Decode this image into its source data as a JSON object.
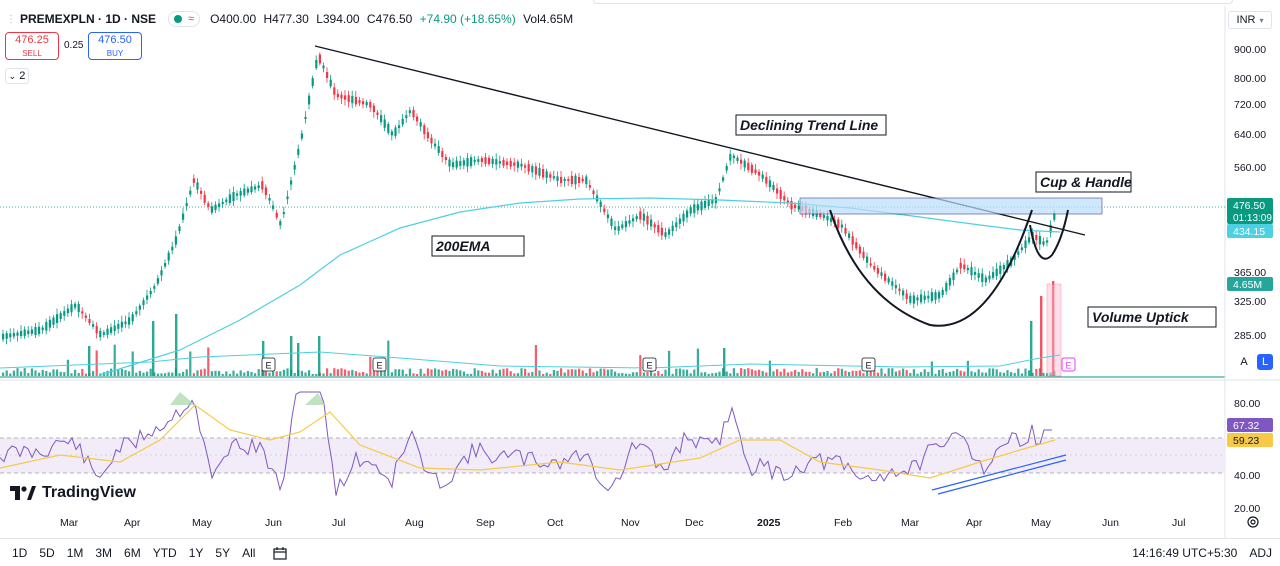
{
  "legend": {
    "symbol": "PREMEXPLN · 1D · NSE",
    "open": "O400.00",
    "high": "H477.30",
    "low": "L394.00",
    "close": "C476.50",
    "change": "+74.90 (+18.65%)",
    "volume": "Vol4.65M"
  },
  "trade": {
    "sell_price": "476.25",
    "sell_label": "SELL",
    "spread": "0.25",
    "buy_price": "476.50",
    "buy_label": "BUY"
  },
  "collapse_count": "2",
  "currency": "INR",
  "price_axis": {
    "ticks": [
      "900.00",
      "800.00",
      "720.00",
      "640.00",
      "560.00",
      "365.00",
      "325.00",
      "285.00"
    ],
    "last_price": "476.50",
    "countdown": "01:13:09",
    "ema_value": "434.15",
    "volume_value": "4.65M"
  },
  "rsi_axis": {
    "ticks": [
      "80.00",
      "40.00",
      "20.00"
    ],
    "rsi_value": "67.32",
    "rsi_ma_value": "59.23"
  },
  "time_axis": [
    "Mar",
    "Apr",
    "May",
    "Jun",
    "Jul",
    "Aug",
    "Sep",
    "Oct",
    "Nov",
    "Dec",
    "2025",
    "Feb",
    "Mar",
    "Apr",
    "May",
    "Jun",
    "Jul"
  ],
  "annotations": {
    "trend_line": "Declining Trend Line",
    "cup_handle": "Cup & Handle",
    "ema200": "200EMA",
    "volume_uptick": "Volume Uptick"
  },
  "earnings_marker": "E",
  "logo_text": "TradingView",
  "timeframes": [
    "1D",
    "5D",
    "1M",
    "3M",
    "6M",
    "YTD",
    "1Y",
    "5Y",
    "All"
  ],
  "clock": "14:16:49 UTC+5:30",
  "adj": "ADJ",
  "scale_buttons": {
    "auto": "A",
    "log": "L"
  },
  "colors": {
    "up": "#089981",
    "down": "#f23645",
    "ema": "#4dd0e1",
    "rsi": "#7e57c2",
    "rsi_ma": "#f7c948",
    "accent": "#2962ff"
  }
}
